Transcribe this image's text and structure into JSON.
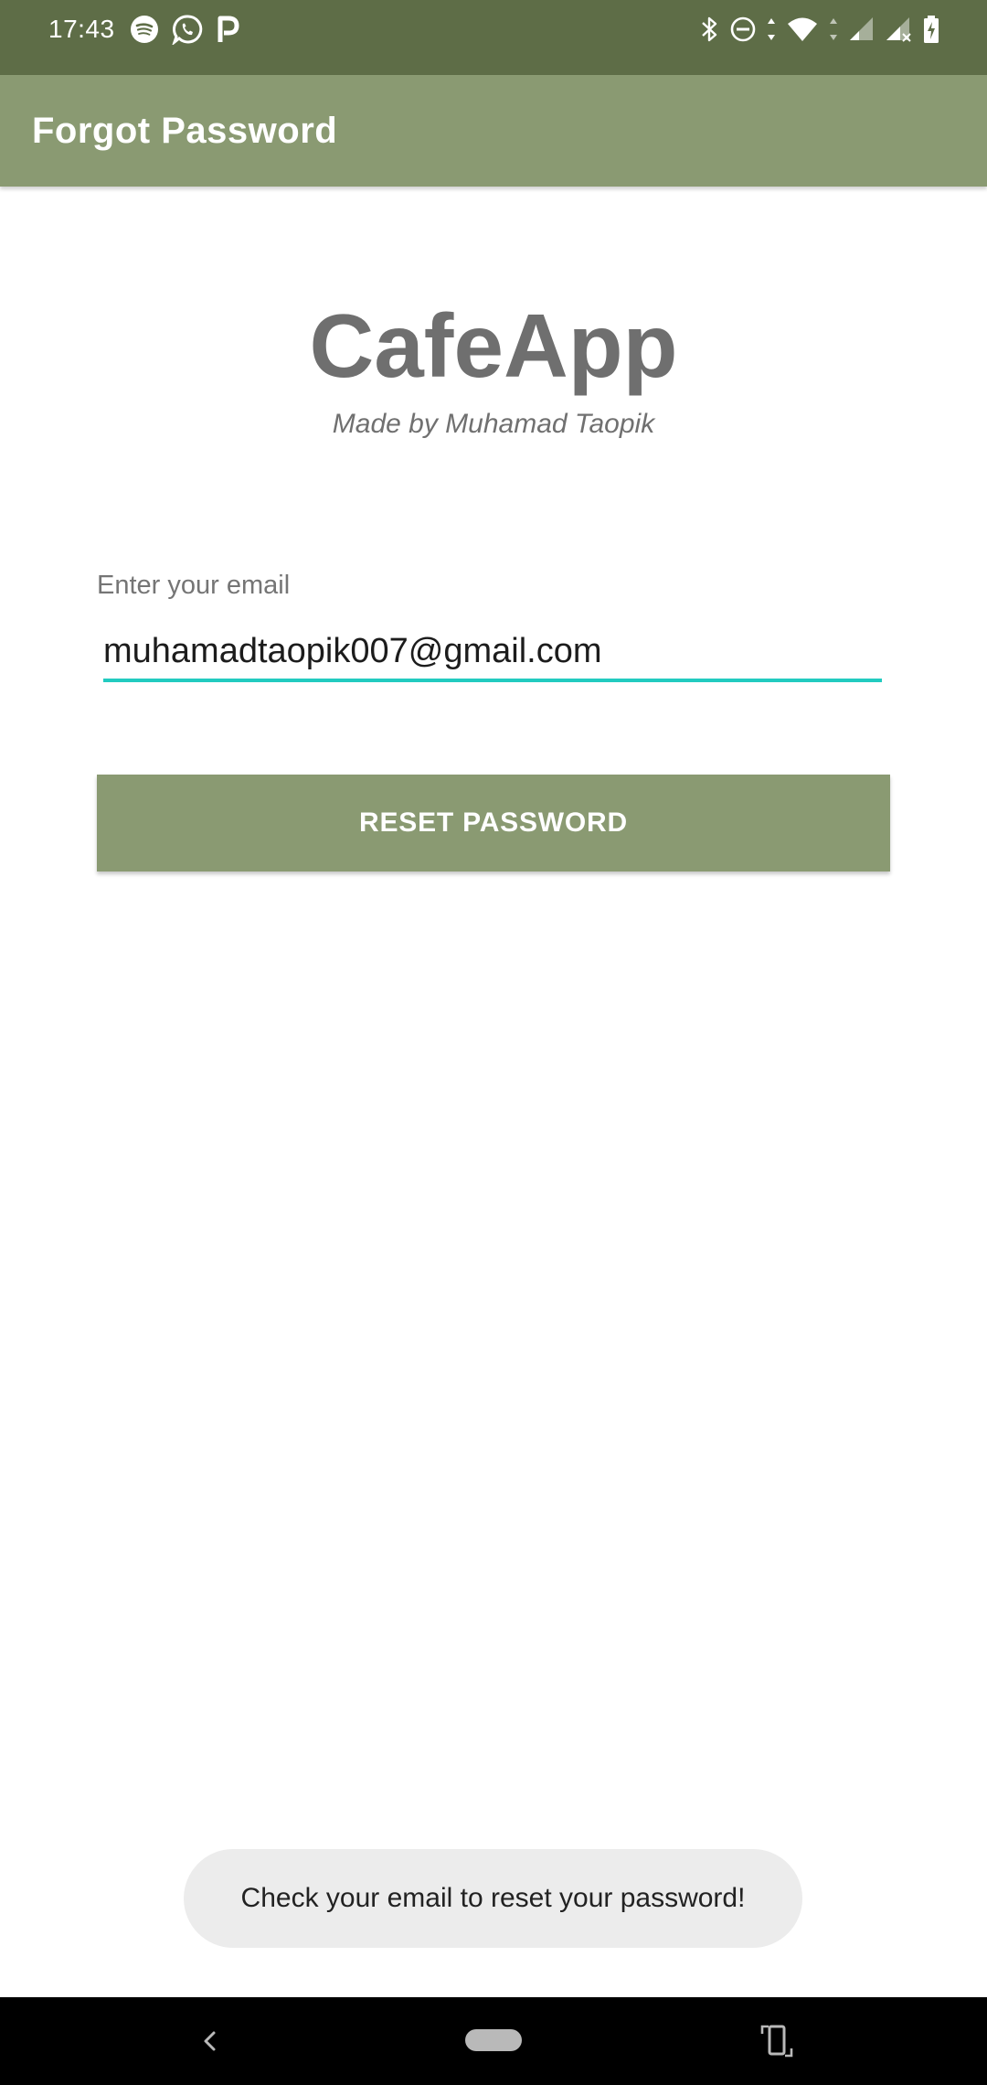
{
  "status_bar": {
    "time": "17:43",
    "left_icons": [
      "spotify-icon",
      "whatsapp-icon",
      "parking-p-icon"
    ],
    "right_icons": [
      "bluetooth-icon",
      "do-not-disturb-icon",
      "data-arrows-icon",
      "wifi-icon",
      "signal-weak-icon",
      "signal-icon",
      "battery-charging-icon"
    ]
  },
  "app_bar": {
    "title": "Forgot Password"
  },
  "logo": {
    "title": "CafeApp",
    "subtitle": "Made by Muhamad Taopik"
  },
  "form": {
    "email_label": "Enter your email",
    "email_value": "muhamadtaopik007@gmail.com",
    "reset_button_label": "RESET PASSWORD"
  },
  "toast": {
    "message": "Check your email to reset your password!"
  },
  "nav_bar": {
    "icons": [
      "back-icon",
      "home-pill-icon",
      "rotate-icon"
    ]
  },
  "colors": {
    "status_bar": "#5e6d47",
    "primary": "#8a9a72",
    "accent": "#22cbc0",
    "logo_text": "#6f6f6f",
    "toast_bg": "#ececec"
  }
}
